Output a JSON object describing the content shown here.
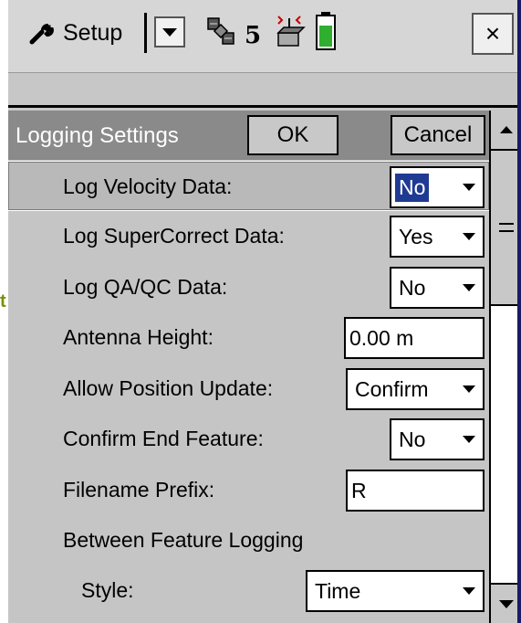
{
  "topbar": {
    "setup_label": "Setup",
    "satellite_count": "5",
    "close_label": "×"
  },
  "background_clip_text": "t",
  "panel": {
    "title": "Logging Settings",
    "ok_label": "OK",
    "cancel_label": "Cancel"
  },
  "fields": [
    {
      "label": "Log Velocity Data:",
      "value": "No",
      "control": "select"
    },
    {
      "label": "Log SuperCorrect Data:",
      "value": "Yes",
      "control": "select"
    },
    {
      "label": "Log QA/QC Data:",
      "value": "No",
      "control": "select"
    },
    {
      "label": "Antenna Height:",
      "value": "0.00 m",
      "control": "text"
    },
    {
      "label": "Allow Position Update:",
      "value": "Confirm",
      "control": "select"
    },
    {
      "label": "Confirm End Feature:",
      "value": "No",
      "control": "select"
    },
    {
      "label": "Filename Prefix:",
      "value": "R",
      "control": "text"
    },
    {
      "label": "Between Feature Logging",
      "control": "heading"
    },
    {
      "label": "Style:",
      "value": "Time",
      "control": "select"
    }
  ],
  "colors": {
    "header_bg": "#8a8a8a",
    "focus_highlight": "#1f3a93",
    "battery_green": "#2fae2f",
    "clip_text": "#7a8f00"
  },
  "icons": [
    "wrench-icon",
    "dropdown-arrow-icon",
    "satellite-icon",
    "gnss-receiver-icon",
    "battery-icon",
    "close-icon",
    "scroll-up-icon",
    "scroll-down-icon"
  ]
}
